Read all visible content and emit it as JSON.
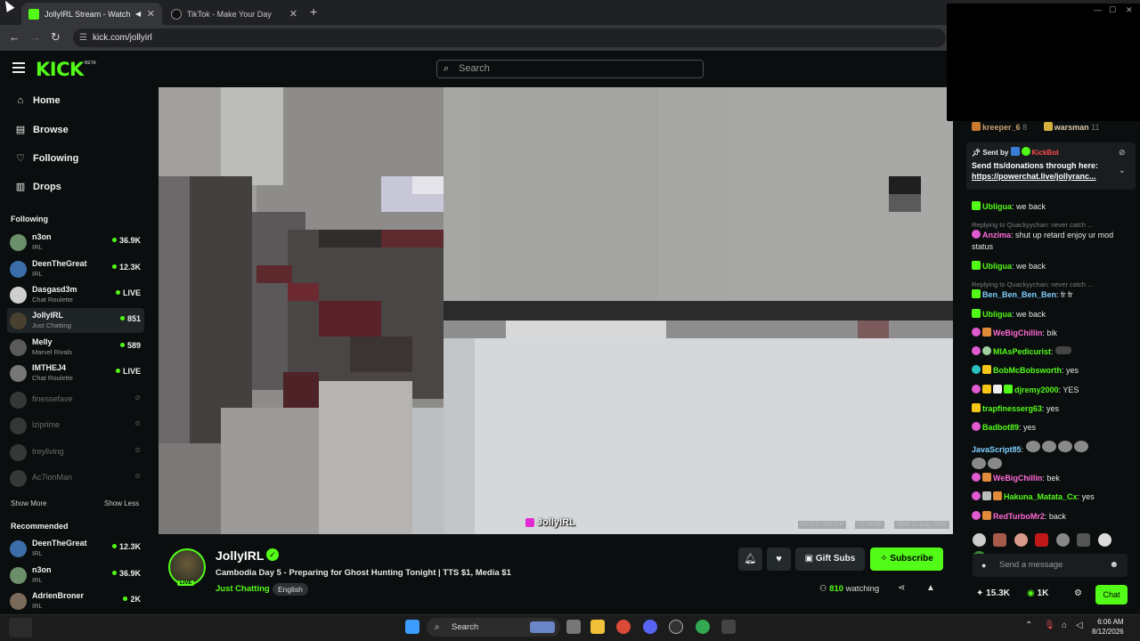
{
  "browser": {
    "tabs": [
      {
        "label": "JollyIRL Stream - Watch Live",
        "favicon_color": "#53fc18",
        "active": true
      },
      {
        "label": "TikTok - Make Your Day",
        "favicon_color": "#111111",
        "active": false
      }
    ],
    "new_tab_label": "+",
    "url": "kick.com/jollyirl"
  },
  "header": {
    "logo": "KICK",
    "logo_badge": "BETA",
    "search_placeholder": "Search"
  },
  "sidebar": {
    "nav": [
      {
        "label": "Home",
        "icon": "home-icon"
      },
      {
        "label": "Browse",
        "icon": "browse-icon"
      },
      {
        "label": "Following",
        "icon": "heart-icon"
      },
      {
        "label": "Drops",
        "icon": "drops-icon"
      }
    ],
    "following_title": "Following",
    "following": [
      {
        "name": "n3on",
        "category": "IRL",
        "viewers": "36.9K",
        "color": "#6b8f6a"
      },
      {
        "name": "DeenTheGreat",
        "category": "IRL",
        "viewers": "12.3K",
        "color": "#3b6ea8"
      },
      {
        "name": "Dasgasd3m",
        "category": "Chat Roulette",
        "viewers": "LIVE",
        "color": "#cfcfcf"
      },
      {
        "name": "JollyIRL",
        "category": "Just Chatting",
        "viewers": "851",
        "color": "#4a4030"
      },
      {
        "name": "Melly",
        "category": "Marvel Rivals",
        "viewers": "589",
        "color": "#5a5a5a"
      },
      {
        "name": "IMTHEJ4",
        "category": "Chat Roulette",
        "viewers": "LIVE",
        "color": "#777777"
      },
      {
        "name": "finessefave",
        "category": "",
        "viewers": "offline",
        "color": "#888888"
      },
      {
        "name": "lziprime",
        "category": "",
        "viewers": "offline",
        "color": "#888888"
      },
      {
        "name": "treyliving",
        "category": "",
        "viewers": "offline",
        "color": "#888888"
      },
      {
        "name": "Ac7ionMan",
        "category": "",
        "viewers": "offline",
        "color": "#888888"
      }
    ],
    "show_more": "Show More",
    "show_less": "Show Less",
    "recommended_title": "Recommended",
    "recommended": [
      {
        "name": "DeenTheGreat",
        "category": "IRL",
        "viewers": "12.3K",
        "color": "#3b6ea8"
      },
      {
        "name": "n3on",
        "category": "IRL",
        "viewers": "36.9K",
        "color": "#6b8f6a"
      },
      {
        "name": "AdrienBroner",
        "category": "IRL",
        "viewers": "2K",
        "color": "#7a6a5a"
      }
    ]
  },
  "video": {
    "watermark": "JollyIRL",
    "overlay": [
      "29.3°C | 84.7°F",
      "17:08:56",
      "Wed 12 Aug 2026"
    ]
  },
  "stream": {
    "name": "JollyIRL",
    "live_badge": "LIVE",
    "title": "Cambodia Day 5 - Preparing for Ghost Hunting Tonight | TTS $1, Media $1",
    "category": "Just Chatting",
    "language": "English",
    "gift_label": "Gift Subs",
    "subscribe_label": "Subscribe",
    "watching_count": "810",
    "watching_label": "watching"
  },
  "chat": {
    "top_users": [
      {
        "name": "kreeper_6",
        "count": "8"
      },
      {
        "name": "warsman",
        "count": "11"
      }
    ],
    "pinned": {
      "sent_by_label": "Sent by",
      "sent_by_user": "KickBot",
      "text": "Send tts/donations through here:",
      "link": "https://powerchat.live/jollyranc..."
    },
    "messages": [
      {
        "user": "Ubligua",
        "color": "#53fc18",
        "text": "we back",
        "badge": "#53fc18"
      },
      {
        "reply": "Replying to Quackyychan: never catch ..."
      },
      {
        "user": "Anzima",
        "color": "#ff6ad5",
        "text": "shut up retard enjoy ur mod status",
        "badge": "#e05ad0"
      },
      {
        "user": "Ubligua",
        "color": "#53fc18",
        "text": "we back",
        "badge": "#53fc18"
      },
      {
        "reply": "Replying to Quackyychan: never catch ..."
      },
      {
        "user": "Ben_Ben_Ben_Ben",
        "color": "#7fd0ff",
        "text": "fr fr",
        "badge": "#53fc18"
      },
      {
        "user": "Ubligua",
        "color": "#53fc18",
        "text": "we back",
        "badge": "#53fc18"
      },
      {
        "user": "WeBigChillin",
        "color": "#ff6ad5",
        "text": "bik",
        "badge": "#e05ad0"
      },
      {
        "user": "MIAsPedicurist",
        "color": "#53fc18",
        "text": "",
        "badge": "#e05ad0"
      },
      {
        "user": "BobMcBobsworth",
        "color": "#53fc18",
        "text": "yes",
        "badge": "#2bc0c0"
      },
      {
        "user": "djremy2000",
        "color": "#53fc18",
        "text": "YES",
        "badge": "#e05ad0"
      },
      {
        "user": "trapfinesserg63",
        "color": "#53fc18",
        "text": "yes",
        "badge": "#f5c518"
      },
      {
        "user": "Badbot89",
        "color": "#53fc18",
        "text": "yes",
        "badge": "#e05ad0"
      },
      {
        "user": "JavaScript85",
        "color": "#7fd0ff",
        "text": "",
        "badge": ""
      },
      {
        "user": "WeBigChillin",
        "color": "#ff6ad5",
        "text": "bek",
        "badge": "#e05ad0"
      },
      {
        "user": "Hakuna_Matata_Cx",
        "color": "#53fc18",
        "text": "yes",
        "badge": "#e05ad0"
      },
      {
        "user": "RedTurboMr2",
        "color": "#ff6ad5",
        "text": "back",
        "badge": "#e05ad0"
      }
    ],
    "input_placeholder": "Send a message",
    "stat_followers": "15.3K",
    "stat_points": "1K",
    "chat_button": "Chat"
  },
  "taskbar": {
    "search_label": "Search",
    "time": "6:06 AM",
    "date": "8/12/2026"
  }
}
